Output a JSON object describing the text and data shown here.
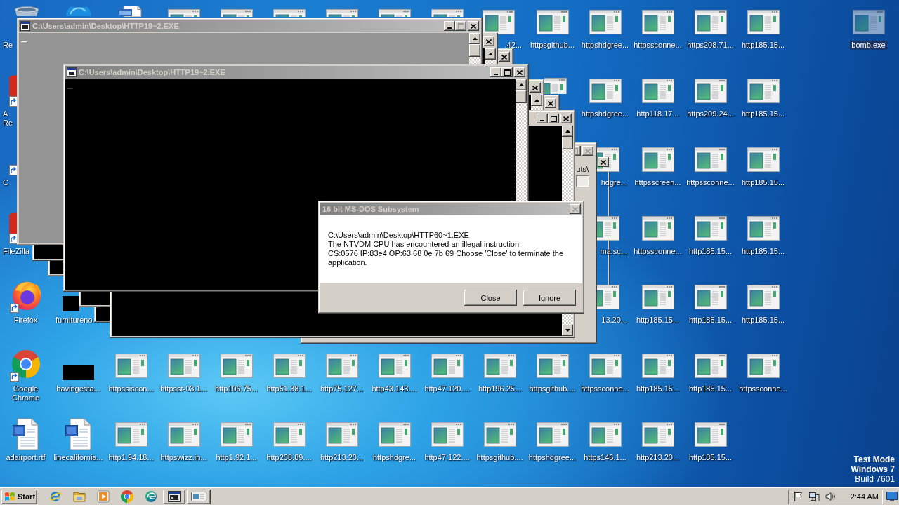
{
  "desktop": {
    "rows": [
      [
        {
          "label": "Re",
          "kind": "bin-top",
          "selected": false
        },
        {
          "kind": "orb-top",
          "selected": false
        },
        {
          "kind": "document-top",
          "selected": false
        },
        {
          "kind": "program-top",
          "selected": false
        },
        {
          "kind": "program-top",
          "selected": false
        },
        {
          "kind": "program-top",
          "selected": false
        },
        {
          "kind": "program-top",
          "selected": false
        },
        {
          "kind": "program-top",
          "selected": false
        },
        {
          "kind": "program-top",
          "selected": false
        },
        {
          "label": ".42...",
          "kind": "program-tail",
          "selected": false
        },
        {
          "label": "httpsgithub...",
          "kind": "program",
          "selected": false
        },
        {
          "label": "httpshdgree...",
          "kind": "program",
          "selected": false
        },
        {
          "label": "httpssconne...",
          "kind": "program",
          "selected": false
        },
        {
          "label": "https208.71...",
          "kind": "program",
          "selected": false
        },
        {
          "label": "http185.15...",
          "kind": "program",
          "selected": false
        },
        null,
        {
          "label": "bomb.exe",
          "kind": "program",
          "selected": true
        }
      ],
      [
        {
          "label": "A\nRe",
          "kind": "shortcut-red-edge",
          "selected": false
        },
        null,
        null,
        null,
        null,
        null,
        null,
        null,
        null,
        null,
        {
          "kind": "program-peek",
          "selected": false
        },
        {
          "label": "httpshdgree...",
          "kind": "program",
          "selected": false
        },
        {
          "label": "http118.17...",
          "kind": "program",
          "selected": false
        },
        {
          "label": "https209.24...",
          "kind": "program",
          "selected": false
        },
        {
          "label": "http185.15...",
          "kind": "program",
          "selected": false
        },
        null,
        null
      ],
      [
        {
          "label": "C",
          "kind": "shortcut-edge",
          "selected": false
        },
        null,
        null,
        null,
        null,
        null,
        null,
        null,
        null,
        null,
        null,
        {
          "label": "hdgre...",
          "kind": "program-edge",
          "selected": false
        },
        {
          "label": "httpsscreen...",
          "kind": "program",
          "selected": false
        },
        {
          "label": "httpssconne...",
          "kind": "program",
          "selected": false
        },
        {
          "label": "http185.15...",
          "kind": "program",
          "selected": false
        },
        null,
        null
      ],
      [
        {
          "label": "FileZilla",
          "kind": "shortcut-red-edge",
          "selected": false
        },
        null,
        null,
        null,
        null,
        null,
        null,
        null,
        null,
        null,
        null,
        {
          "label": "ma.sc...",
          "kind": "program-edge",
          "selected": false
        },
        {
          "label": "httpssconne...",
          "kind": "program",
          "selected": false
        },
        {
          "label": "http185.15...",
          "kind": "program",
          "selected": false
        },
        {
          "label": "http185.15...",
          "kind": "program",
          "selected": false
        },
        null,
        null
      ],
      [
        {
          "label": "Firefox",
          "kind": "firefox",
          "selected": false
        },
        {
          "label": "furnitureno",
          "kind": "tile-edge",
          "selected": false
        },
        null,
        null,
        null,
        null,
        null,
        null,
        null,
        null,
        null,
        {
          "label": "13.20...",
          "kind": "program-edge",
          "selected": false
        },
        {
          "label": "http185.15...",
          "kind": "program",
          "selected": false
        },
        {
          "label": "http185.15...",
          "kind": "program",
          "selected": false
        },
        {
          "label": "http185.15...",
          "kind": "program",
          "selected": false
        },
        null,
        null
      ],
      [
        {
          "label": "Google Chrome",
          "kind": "chrome",
          "selected": false
        },
        {
          "label": "havingesta...",
          "kind": "tile",
          "selected": false
        },
        {
          "label": "httpssiscon...",
          "kind": "program",
          "selected": false
        },
        {
          "label": "httpsst-03.1...",
          "kind": "program",
          "selected": false
        },
        {
          "label": "http106.75...",
          "kind": "program",
          "selected": false
        },
        {
          "label": "http51.38.1...",
          "kind": "program",
          "selected": false
        },
        {
          "label": "http75.127...",
          "kind": "program",
          "selected": false
        },
        {
          "label": "http43.143....",
          "kind": "program",
          "selected": false
        },
        {
          "label": "http47.120....",
          "kind": "program",
          "selected": false
        },
        {
          "label": "http196.25...",
          "kind": "program",
          "selected": false
        },
        {
          "label": "httpsgithub....",
          "kind": "program",
          "selected": false
        },
        {
          "label": "httpssconne...",
          "kind": "program",
          "selected": false
        },
        {
          "label": "http185.15...",
          "kind": "program",
          "selected": false
        },
        {
          "label": "http185.15...",
          "kind": "program",
          "selected": false
        },
        {
          "label": "httpssconne...",
          "kind": "program",
          "selected": false
        },
        null,
        null
      ],
      [
        {
          "label": "adairport.rtf",
          "kind": "document",
          "selected": false
        },
        {
          "label": "linecalifornia...",
          "kind": "document",
          "selected": false
        },
        {
          "label": "http1.94.18...",
          "kind": "program",
          "selected": false
        },
        {
          "label": "httpswizz.in...",
          "kind": "program",
          "selected": false
        },
        {
          "label": "http1.92.1...",
          "kind": "program",
          "selected": false
        },
        {
          "label": "http208.89....",
          "kind": "program",
          "selected": false
        },
        {
          "label": "http213.20...",
          "kind": "program",
          "selected": false
        },
        {
          "label": "httpshdgre...",
          "kind": "program",
          "selected": false
        },
        {
          "label": "http47.122....",
          "kind": "program",
          "selected": false
        },
        {
          "label": "httpsgithub....",
          "kind": "program",
          "selected": false
        },
        {
          "label": "httpshdgree...",
          "kind": "program",
          "selected": false
        },
        {
          "label": "https146.1...",
          "kind": "program",
          "selected": false
        },
        {
          "label": "http213.20...",
          "kind": "program",
          "selected": false
        },
        {
          "label": "http185.15...",
          "kind": "program",
          "selected": false
        },
        null,
        null,
        null
      ]
    ]
  },
  "desktop_notice": [
    {
      "text": "Test Mode",
      "kind": "mode"
    },
    {
      "text": "Windows 7",
      "kind": "edition"
    },
    {
      "text": "Build 7601",
      "kind": "build"
    }
  ],
  "console_windows": [
    {
      "title": "C:\\Users\\admin\\Desktop\\HTTP19~2.EXE",
      "kind": "gray",
      "screen_text": "_",
      "controls": [
        {
          "kind": "minimize",
          "disabled": false
        },
        {
          "kind": "maximize",
          "disabled": true
        },
        {
          "kind": "close",
          "disabled": false
        }
      ],
      "scrollbar": [
        {
          "kind": "up"
        },
        {
          "kind": "thumb"
        }
      ]
    },
    {
      "kind": "console",
      "controls": [
        {
          "kind": "close",
          "disabled": false
        }
      ],
      "scrollbar": [
        {
          "kind": "up"
        }
      ]
    },
    {
      "kind": "console",
      "controls": [
        {
          "kind": "close",
          "disabled": false
        }
      ]
    },
    {
      "title": "C:\\Users\\admin\\Desktop\\HTTP19~2.EXE",
      "kind": "console",
      "screen_text": "_",
      "controls": [
        {
          "kind": "minimize",
          "disabled": false
        },
        {
          "kind": "maximize",
          "disabled": false
        },
        {
          "kind": "close",
          "disabled": false
        }
      ],
      "scrollbar": [
        {
          "kind": "up"
        },
        {
          "kind": "thumb"
        }
      ]
    },
    {
      "kind": "console",
      "controls": [
        {
          "kind": "close",
          "disabled": false
        }
      ],
      "scrollbar": [
        {
          "kind": "up"
        }
      ]
    },
    {
      "kind": "console",
      "controls": [
        {
          "kind": "close",
          "disabled": false
        }
      ]
    },
    {
      "kind": "console",
      "controls": [
        {
          "kind": "minimize",
          "disabled": false
        },
        {
          "kind": "maximize",
          "disabled": false
        },
        {
          "kind": "close",
          "disabled": false
        }
      ],
      "scrollbar": [
        {
          "kind": "up"
        },
        {
          "kind": "thumb"
        },
        {
          "kind": "down"
        }
      ]
    }
  ],
  "unresponsive_windows": [
    {
      "kind": "panel",
      "text": "uts\\",
      "controls": [
        {
          "kind": "maximize-edge",
          "disabled": true
        },
        {
          "kind": "close",
          "disabled": true
        }
      ]
    },
    {
      "kind": "outline",
      "controls": [
        {
          "kind": "close",
          "disabled": false
        }
      ]
    }
  ],
  "dialog": {
    "title": "16 bit MS-DOS Subsystem",
    "controls": [
      {
        "kind": "close",
        "disabled": true
      }
    ],
    "message_lines": [
      "C:\\Users\\admin\\Desktop\\HTTP60~1.EXE",
      "The NTVDM CPU has encountered an illegal instruction.",
      "CS:0576 IP:83e4 OP:63 68 0e 7b 69 Choose 'Close' to terminate the application."
    ],
    "buttons": [
      "Close",
      "Ignore"
    ]
  },
  "taskbar": {
    "start_button": {
      "label": "Start"
    },
    "quick_launch": [
      {
        "kind": "e-orbit"
      },
      {
        "kind": "folder"
      },
      {
        "kind": "play"
      },
      {
        "kind": "tricolor"
      },
      {
        "kind": "swirl"
      }
    ],
    "task_buttons": [
      {
        "kind": "dos-window"
      },
      {
        "kind": "window"
      }
    ],
    "tray_icons": [
      {
        "kind": "flag"
      },
      {
        "kind": "monitor"
      },
      {
        "kind": "speaker"
      }
    ],
    "clock": "2:44 AM"
  }
}
